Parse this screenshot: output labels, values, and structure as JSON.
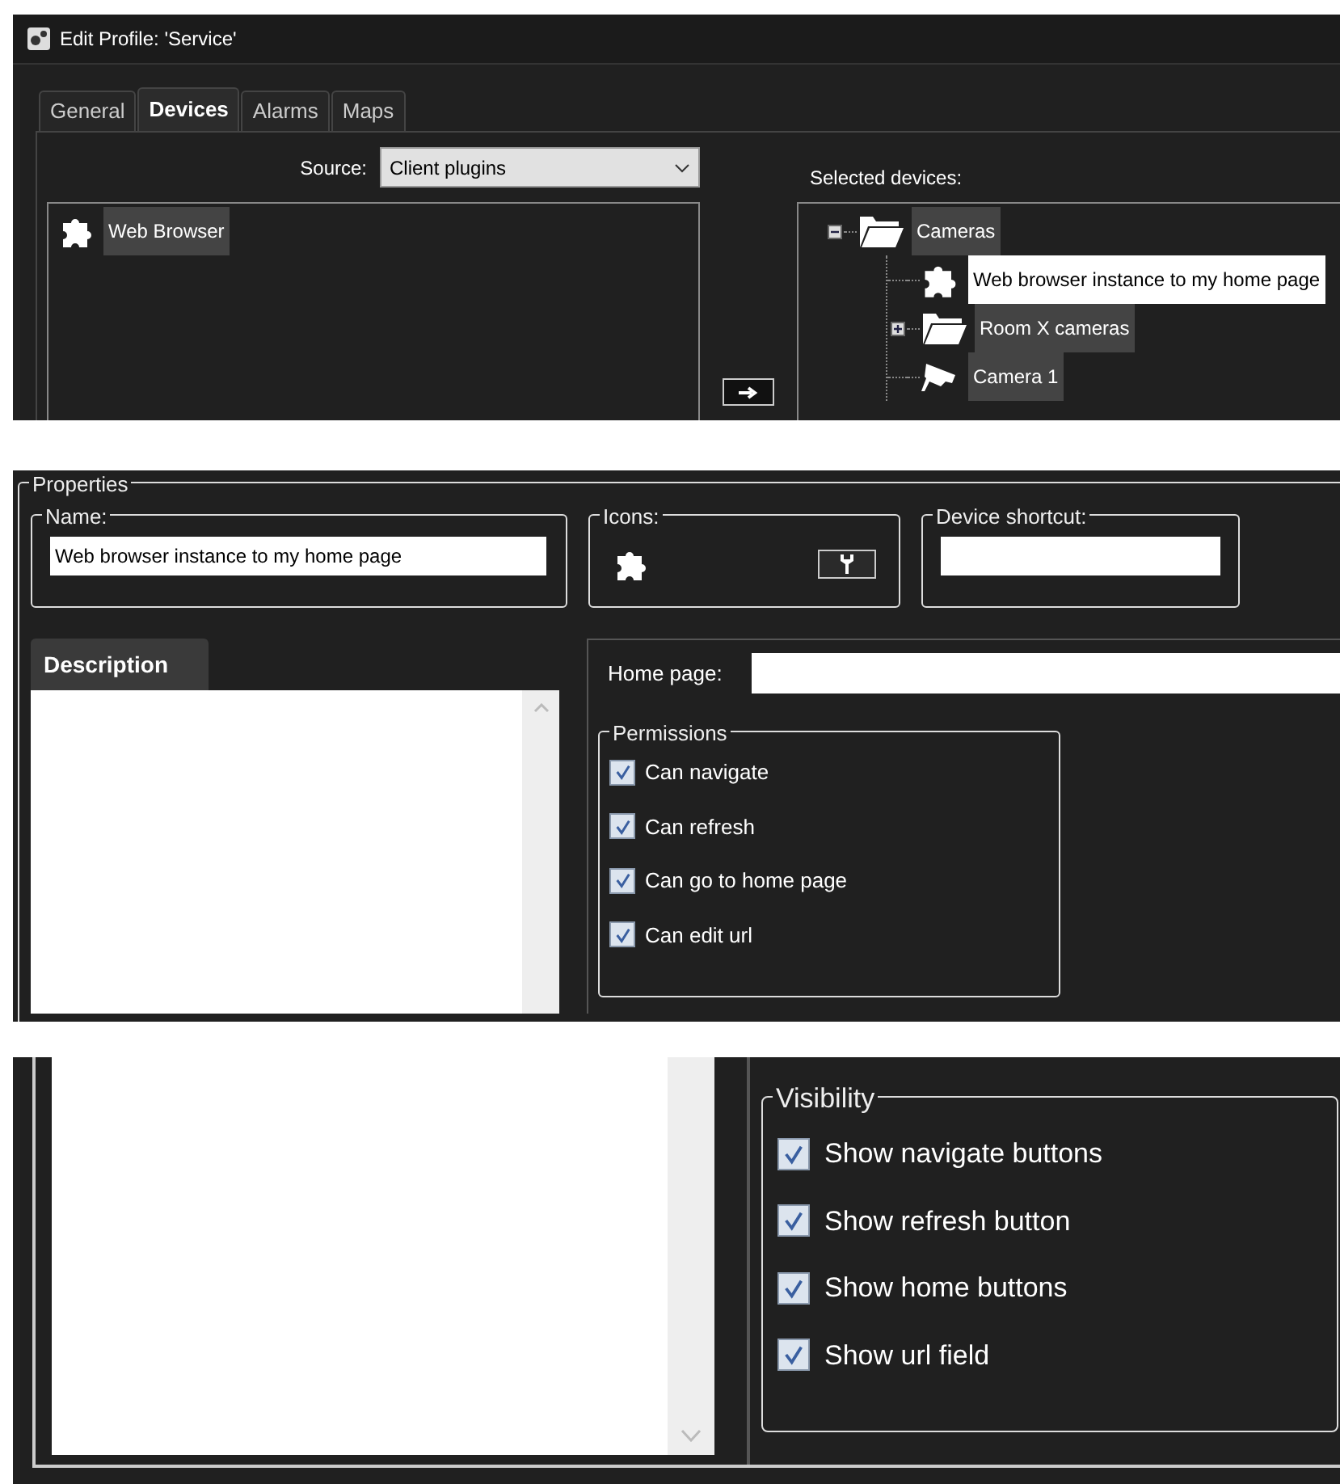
{
  "window": {
    "title": "Edit Profile: 'Service'"
  },
  "tabs": [
    {
      "label": "General",
      "selected": false
    },
    {
      "label": "Devices",
      "selected": true
    },
    {
      "label": "Alarms",
      "selected": false
    },
    {
      "label": "Maps",
      "selected": false
    }
  ],
  "source": {
    "label": "Source:",
    "value": "Client plugins"
  },
  "available_devices": [
    {
      "label": "Web Browser",
      "kind": "plugin",
      "selected": false
    }
  ],
  "selected_devices": {
    "label": "Selected devices:",
    "tree": [
      {
        "label": "Cameras",
        "kind": "folder",
        "expanded": true,
        "selected": false,
        "children": [
          {
            "label": "Web browser instance to my home page",
            "kind": "plugin",
            "selected": true
          },
          {
            "label": "Room X cameras",
            "kind": "folder",
            "expanded": false,
            "selected": false
          },
          {
            "label": "Camera 1",
            "kind": "camera",
            "selected": false
          }
        ]
      }
    ]
  },
  "properties": {
    "title": "Properties",
    "name": {
      "label": "Name:",
      "value": "Web browser instance to my home page"
    },
    "icons": {
      "label": "Icons:"
    },
    "device_shortcut": {
      "label": "Device shortcut:"
    },
    "description": {
      "tab": "Description"
    },
    "home_page": {
      "label": "Home page:"
    },
    "permissions": {
      "title": "Permissions",
      "items": [
        {
          "label": "Can navigate",
          "checked": true
        },
        {
          "label": "Can refresh",
          "checked": true
        },
        {
          "label": "Can go to home page",
          "checked": true
        },
        {
          "label": "Can edit url",
          "checked": true
        }
      ]
    },
    "visibility": {
      "title": "Visibility",
      "items": [
        {
          "label": "Show navigate buttons",
          "checked": true
        },
        {
          "label": "Show refresh button",
          "checked": true
        },
        {
          "label": "Show home buttons",
          "checked": true
        },
        {
          "label": "Show url field",
          "checked": true
        }
      ]
    }
  }
}
